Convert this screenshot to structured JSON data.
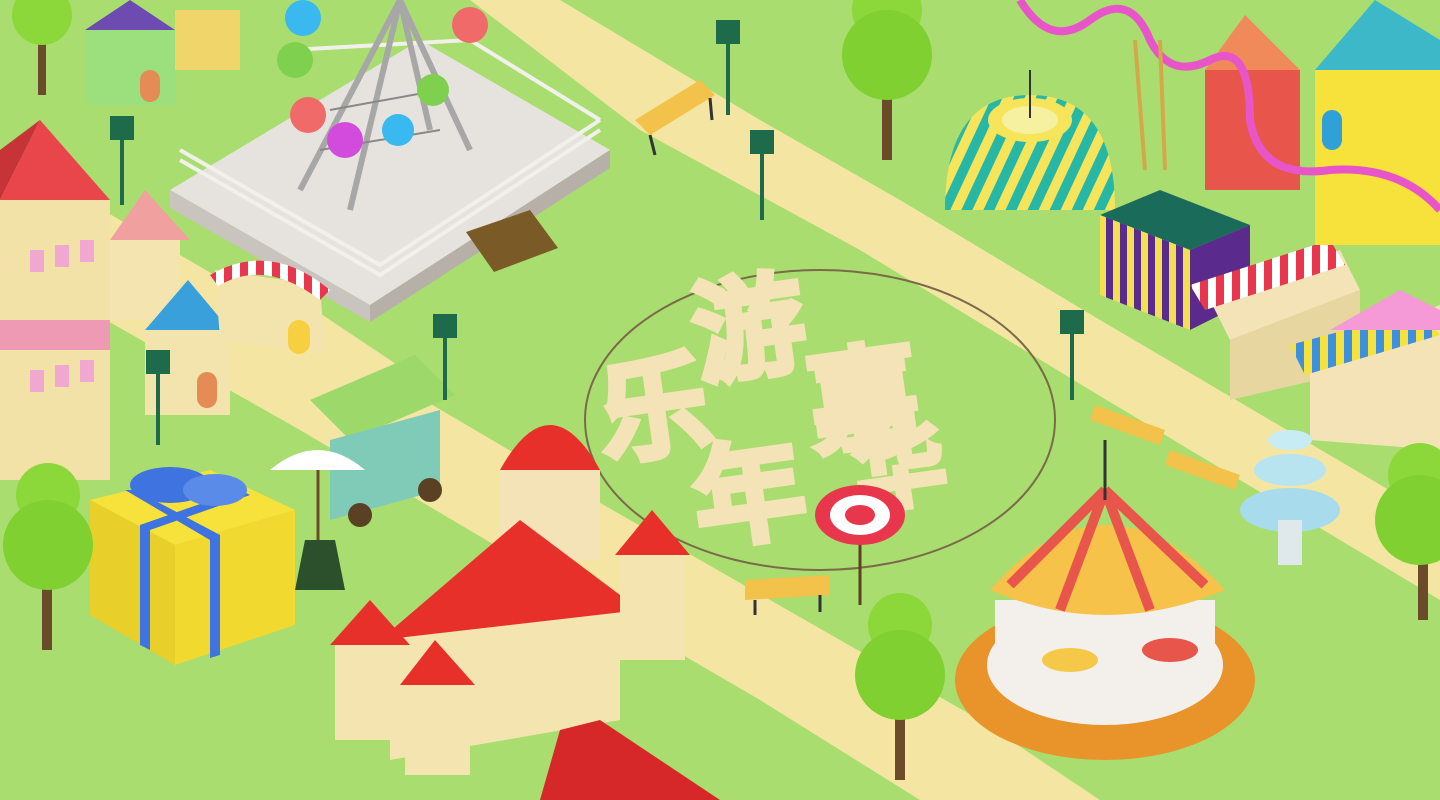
{
  "scene": {
    "sign_chars": [
      "游",
      "乐",
      "嘉",
      "年",
      "华"
    ],
    "colors": {
      "grass": "#a9dd6f",
      "path": "#f4e6a2",
      "plaza": "#ecebe8",
      "roof_red": "#e8302a",
      "teal": "#2fb6b0",
      "yellow": "#f6e23a",
      "pink": "#e855c8",
      "tree": "#8cd83a",
      "cream": "#f3e3b6"
    }
  }
}
